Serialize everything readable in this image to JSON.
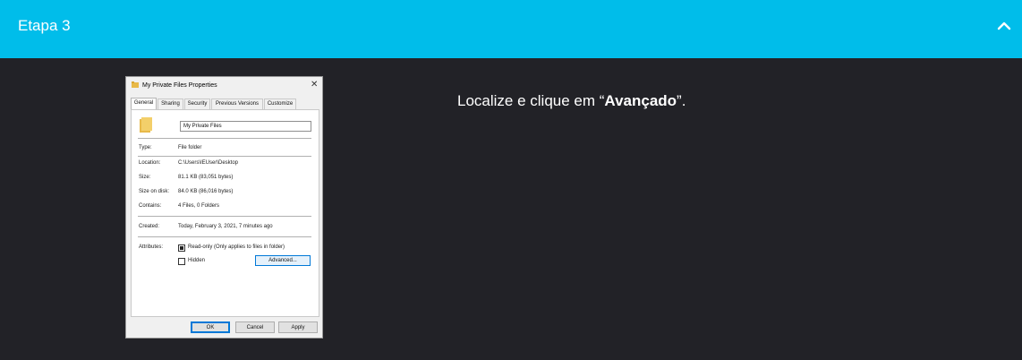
{
  "header": {
    "title": "Etapa 3",
    "toggle_icon": "chevron-up-icon",
    "color": "#00bdea"
  },
  "instruction": {
    "before": "Localize e clique em “",
    "bold": "Avançado",
    "after": "”."
  },
  "dialog": {
    "title": "My Private Files Properties",
    "close_glyph": "✕",
    "tabs": [
      "General",
      "Sharing",
      "Security",
      "Previous Versions",
      "Customize"
    ],
    "folder_name": "My Private Files",
    "properties": {
      "type_label": "Type:",
      "type_value": "File folder",
      "location_label": "Location:",
      "location_value": "C:\\Users\\IEUser\\Desktop",
      "size_label": "Size:",
      "size_value": "81.1 KB (83,051 bytes)",
      "size_on_disk_label": "Size on disk:",
      "size_on_disk_value": "84.0 KB (86,016 bytes)",
      "contains_label": "Contains:",
      "contains_value": "4 Files, 0 Folders",
      "created_label": "Created:",
      "created_value": "Today, February 3, 2021, 7 minutes ago",
      "attributes_label": "Attributes:"
    },
    "attributes": {
      "readonly_label": "Read-only (Only applies to files in folder)",
      "hidden_label": "Hidden",
      "advanced_label": "Advanced..."
    },
    "buttons": {
      "ok": "OK",
      "cancel": "Cancel",
      "apply": "Apply"
    }
  }
}
